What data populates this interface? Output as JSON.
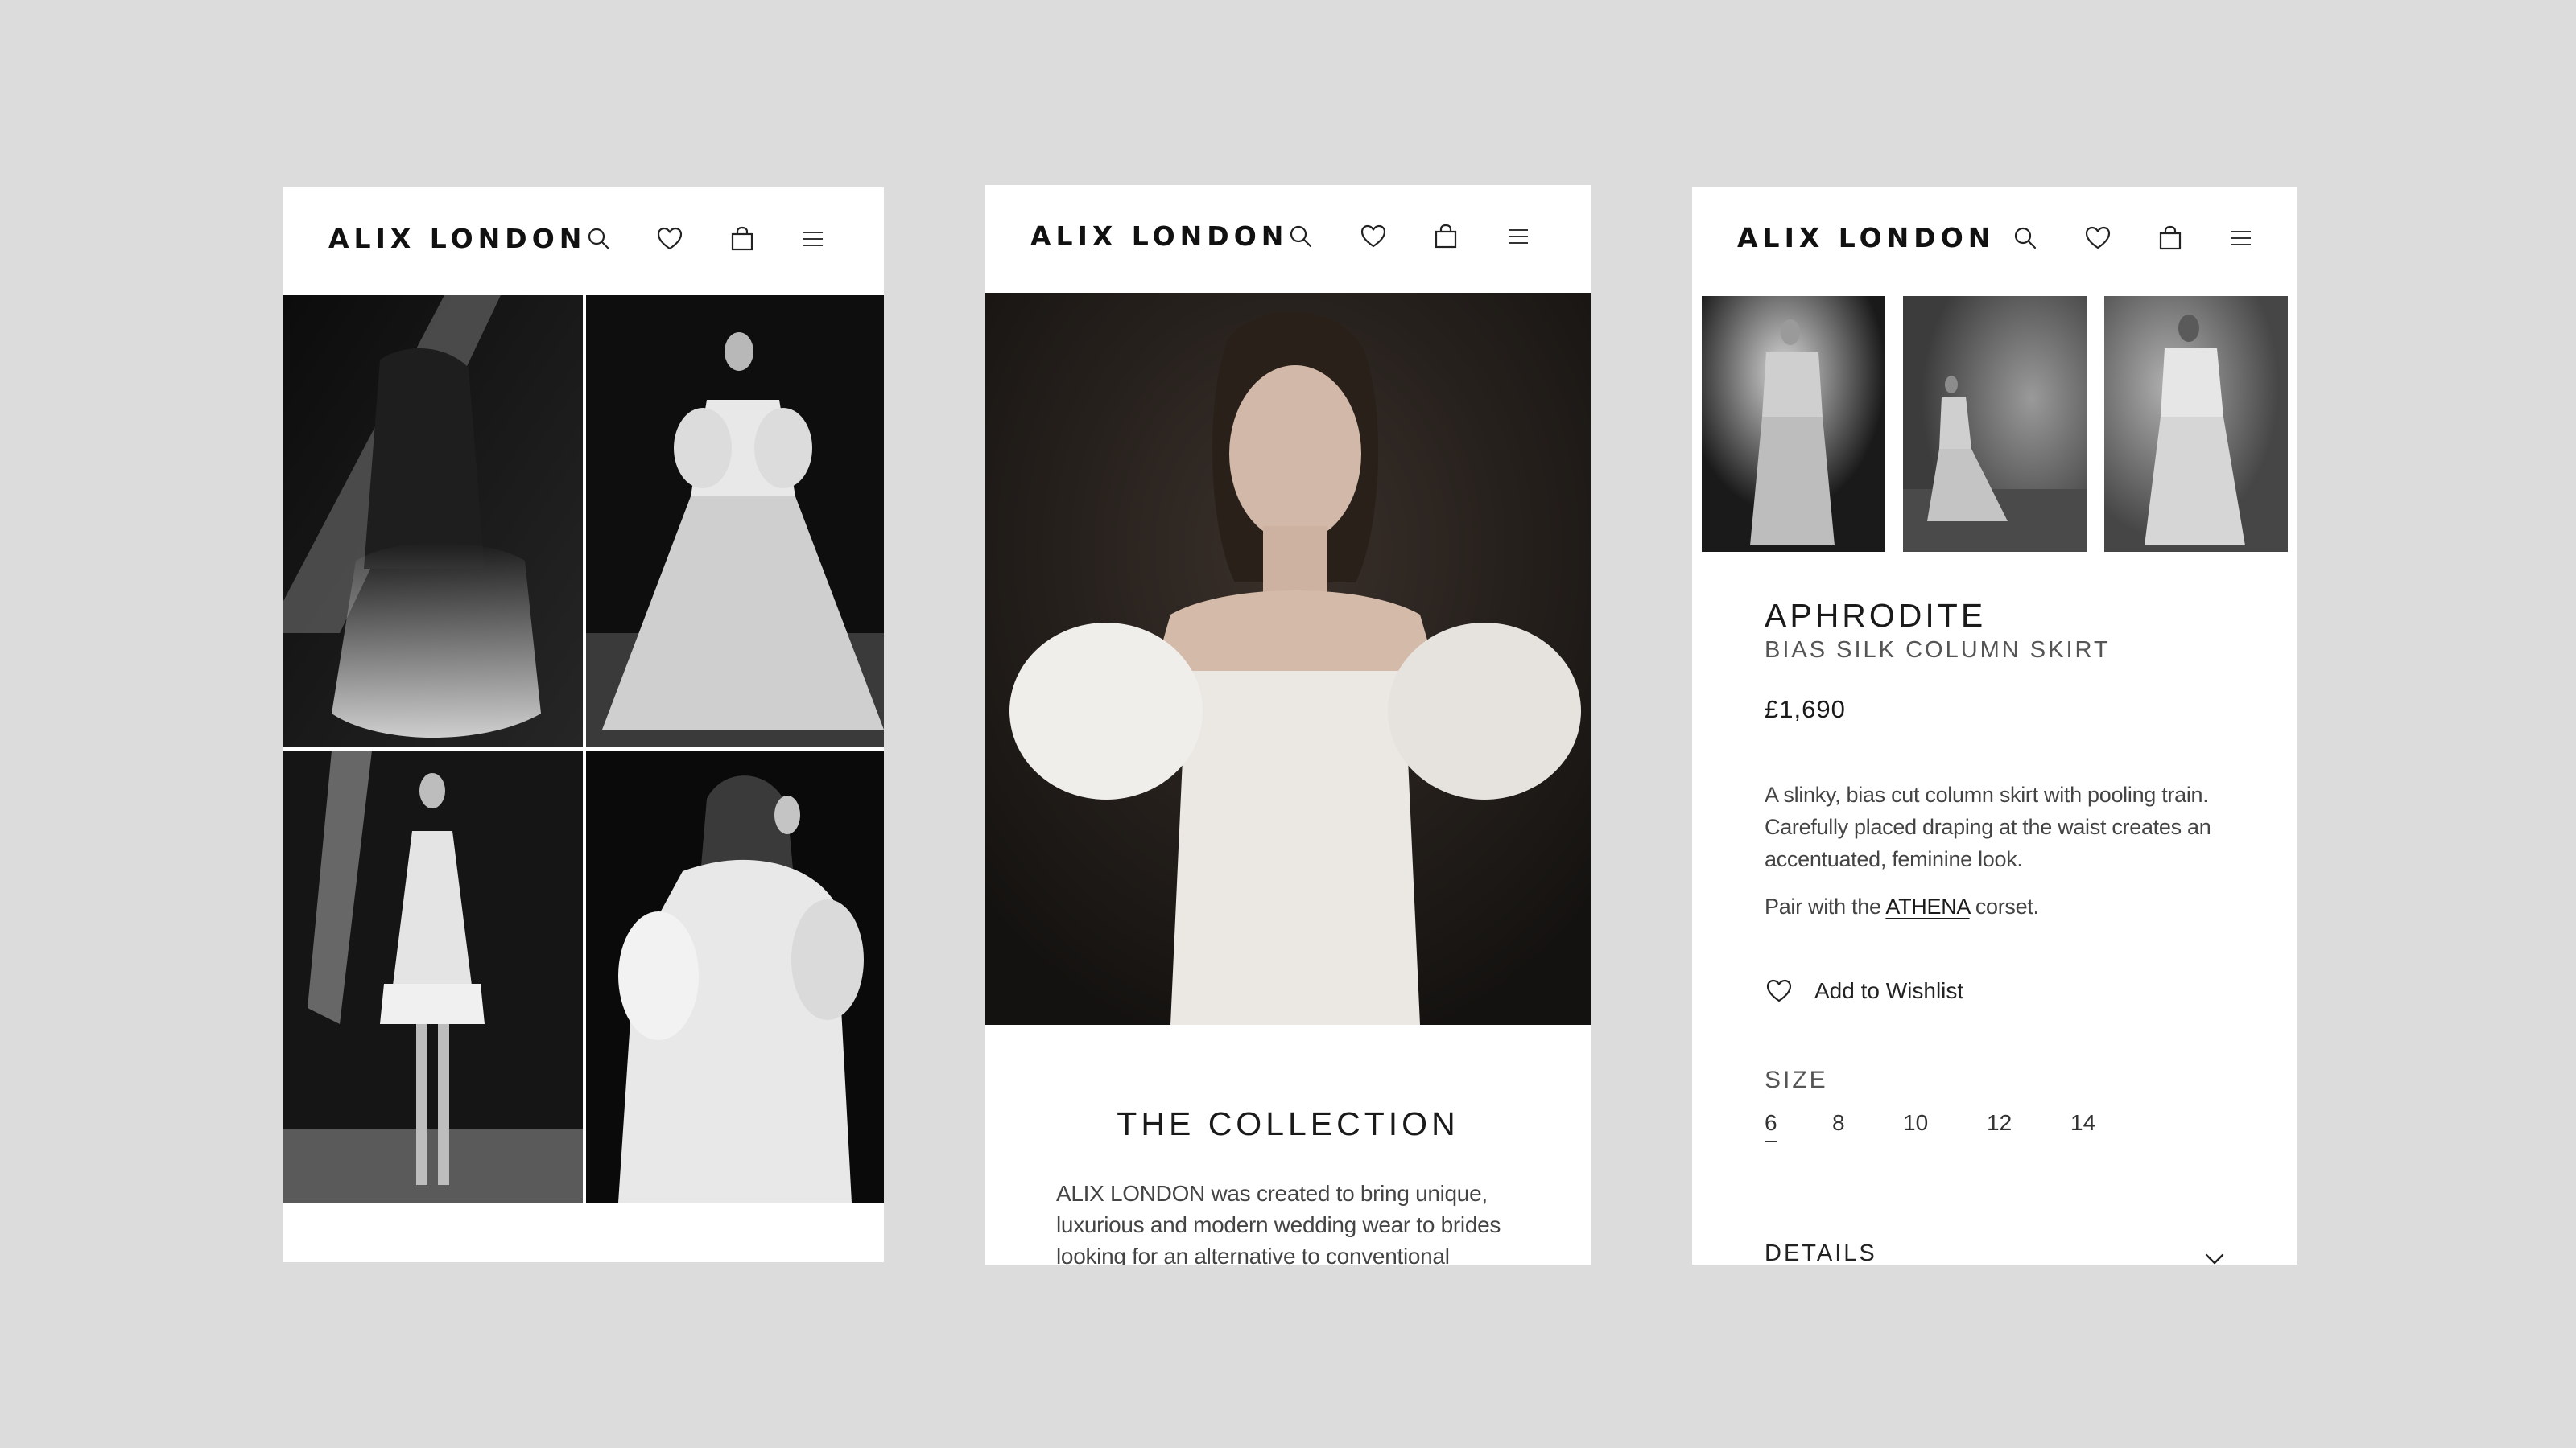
{
  "brand": {
    "logo_text": "ALIX LONDON"
  },
  "icons": {
    "search": "search-icon",
    "wishlist": "heart-icon",
    "bag": "shopping-bag-icon",
    "menu": "hamburger-menu-icon"
  },
  "collection": {
    "title": "THE COLLECTION",
    "body": "ALIX LONDON was created to bring unique, luxurious and modern wedding wear to brides looking for an alternative to conventional"
  },
  "product": {
    "name": "APHRODITE",
    "subtitle": "BIAS SILK COLUMN SKIRT",
    "price": "£1,690",
    "description": "A slinky, bias cut column skirt with pooling train. Carefully placed draping at the waist creates an accentuated, feminine look.",
    "pair_prefix": "Pair with the ",
    "pair_link": "ATHENA",
    "pair_suffix": " corset.",
    "wishlist_label": "Add to Wishlist",
    "size_label": "SIZE",
    "sizes": [
      "6",
      "8",
      "10",
      "12",
      "14"
    ],
    "selected_size": "6",
    "details_label": "DETAILS"
  },
  "colors": {
    "background": "#dcdcdc",
    "panel": "#ffffff",
    "text": "#1a1a1a"
  }
}
